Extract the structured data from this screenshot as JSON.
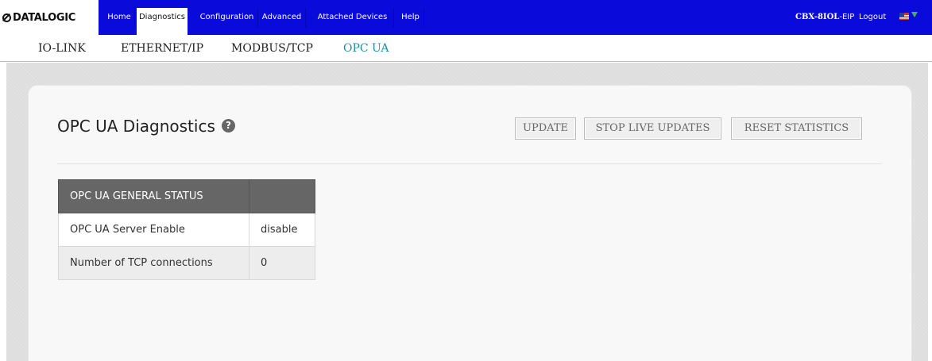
{
  "brand": {
    "logo_text": "DATALOGIC"
  },
  "nav": {
    "items": [
      {
        "label": "Home",
        "active": false
      },
      {
        "label": "Diagnostics",
        "active": true
      },
      {
        "label": "Configuration",
        "active": false
      },
      {
        "label": "Advanced",
        "active": false
      },
      {
        "label": "Attached Devices",
        "active": false
      },
      {
        "label": "Help",
        "active": false
      }
    ],
    "device_name_bold": "CBX-8IOL",
    "device_name_suffix": "-EIP",
    "logout_label": "Logout",
    "language_icon": "us-flag-icon"
  },
  "subtabs": {
    "items": [
      {
        "label": "IO-LINK",
        "active": false
      },
      {
        "label": "ETHERNET/IP",
        "active": false
      },
      {
        "label": "MODBUS/TCP",
        "active": false
      },
      {
        "label": "OPC UA",
        "active": true
      }
    ]
  },
  "page": {
    "title": "OPC UA Diagnostics",
    "help_glyph": "?",
    "buttons": {
      "update": "UPDATE",
      "stop_live": "STOP LIVE UPDATES",
      "reset_stats": "RESET STATISTICS"
    }
  },
  "status_table": {
    "header": "OPC UA GENERAL STATUS",
    "header_value": "",
    "rows": [
      {
        "label": "OPC UA Server Enable",
        "value": "disable"
      },
      {
        "label": "Number of TCP connections",
        "value": "0"
      }
    ]
  },
  "colors": {
    "nav_bg": "#0a0adb",
    "active_subtab": "#1a8fa0",
    "table_header_bg": "#666666"
  }
}
